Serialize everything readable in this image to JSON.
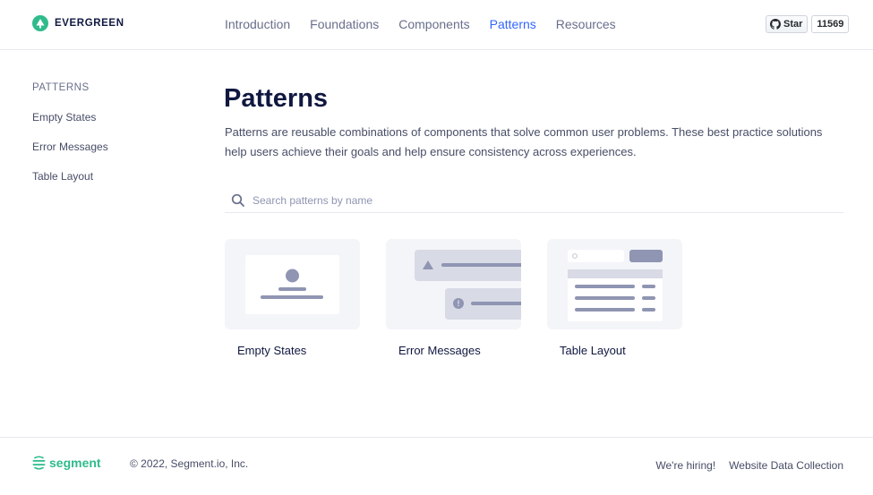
{
  "header": {
    "brand": "EVERGREEN",
    "nav": [
      {
        "label": "Introduction",
        "active": false
      },
      {
        "label": "Foundations",
        "active": false
      },
      {
        "label": "Components",
        "active": false
      },
      {
        "label": "Patterns",
        "active": true
      },
      {
        "label": "Resources",
        "active": false
      }
    ],
    "github": {
      "star_label": "Star",
      "count": "11569"
    }
  },
  "sidebar": {
    "heading": "PATTERNS",
    "items": [
      {
        "label": "Empty States"
      },
      {
        "label": "Error Messages"
      },
      {
        "label": "Table Layout"
      }
    ]
  },
  "main": {
    "title": "Patterns",
    "description": "Patterns are reusable combinations of components that solve common user problems. These best practice solutions help users achieve their goals and help ensure consistency across experiences.",
    "search": {
      "placeholder": "Search patterns by name",
      "value": ""
    },
    "cards": [
      {
        "label": "Empty States",
        "icon": "empty-states-illustration"
      },
      {
        "label": "Error Messages",
        "icon": "error-messages-illustration"
      },
      {
        "label": "Table Layout",
        "icon": "table-layout-illustration"
      }
    ]
  },
  "footer": {
    "brand": "segment",
    "copyright": "© 2022, Segment.io, Inc.",
    "links": [
      {
        "label": "We're hiring!"
      },
      {
        "label": "Website Data Collection"
      }
    ]
  },
  "colors": {
    "accent": "#3366ff",
    "brand_green": "#2fbb8b",
    "illustration": "#8f95b2",
    "illustration_bg": "#f4f5f9",
    "text_dark": "#101840"
  }
}
